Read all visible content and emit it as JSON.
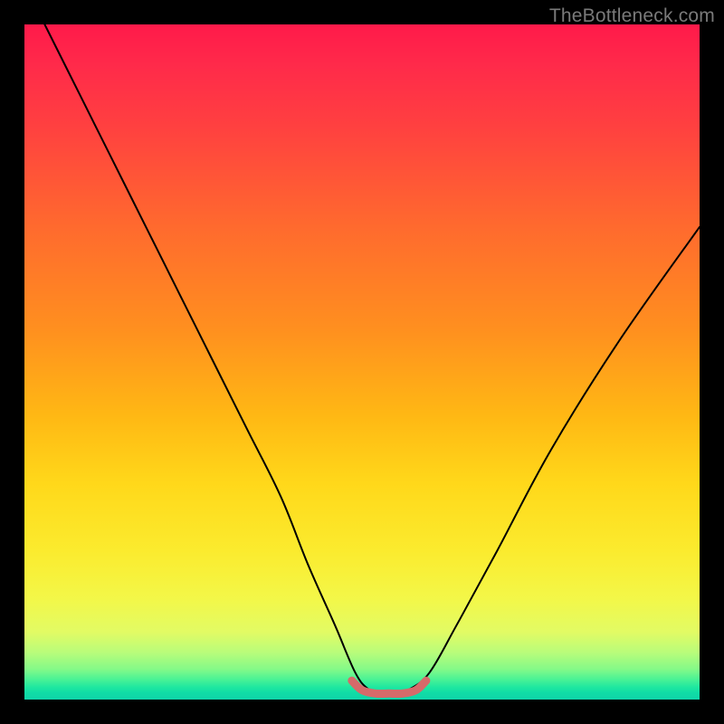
{
  "watermark": "TheBottleneck.com",
  "chart_data": {
    "type": "line",
    "title": "",
    "xlabel": "",
    "ylabel": "",
    "xlim": [
      0,
      100
    ],
    "ylim": [
      0,
      100
    ],
    "grid": false,
    "legend": false,
    "series": [
      {
        "name": "bottleneck-curve",
        "color": "#000000",
        "stroke_width": 2,
        "x": [
          3,
          8,
          13,
          18,
          23,
          28,
          33,
          38,
          42,
          46,
          49,
          51,
          53,
          55,
          57,
          60,
          64,
          70,
          78,
          88,
          100
        ],
        "y": [
          100,
          90,
          80,
          70,
          60,
          50,
          40,
          30,
          20,
          11,
          4,
          1.5,
          0.8,
          0.8,
          1.5,
          4,
          11,
          22,
          37,
          53,
          70
        ]
      },
      {
        "name": "trough-marker",
        "color": "#d66a6a",
        "stroke_width": 9,
        "x": [
          48.5,
          50,
          52,
          54,
          56,
          58,
          59.5
        ],
        "y": [
          2.8,
          1.4,
          0.9,
          0.9,
          0.9,
          1.4,
          2.8
        ]
      }
    ]
  }
}
